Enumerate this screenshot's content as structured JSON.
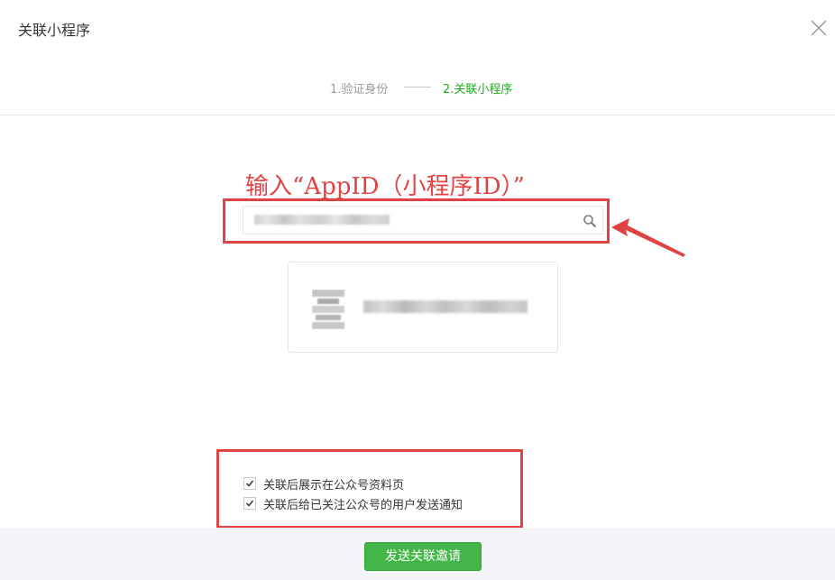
{
  "dialog": {
    "title": "关联小程序",
    "close_icon": "close-icon"
  },
  "steps": [
    {
      "label": "1.验证身份",
      "state": "done"
    },
    {
      "label": "2.关联小程序",
      "state": "active"
    }
  ],
  "annotation": {
    "text": "输入“AppID（小程序ID）”"
  },
  "search": {
    "icon": "search-icon"
  },
  "options": [
    {
      "label": "关联后展示在公众号资料页",
      "checked": true
    },
    {
      "label": "关联后给已关注公众号的用户发送通知",
      "checked": true
    }
  ],
  "footer": {
    "submit_label": "发送关联邀请"
  },
  "colors": {
    "accent": "#1aad19",
    "button": "#44b549",
    "annotation": "#e04343"
  }
}
